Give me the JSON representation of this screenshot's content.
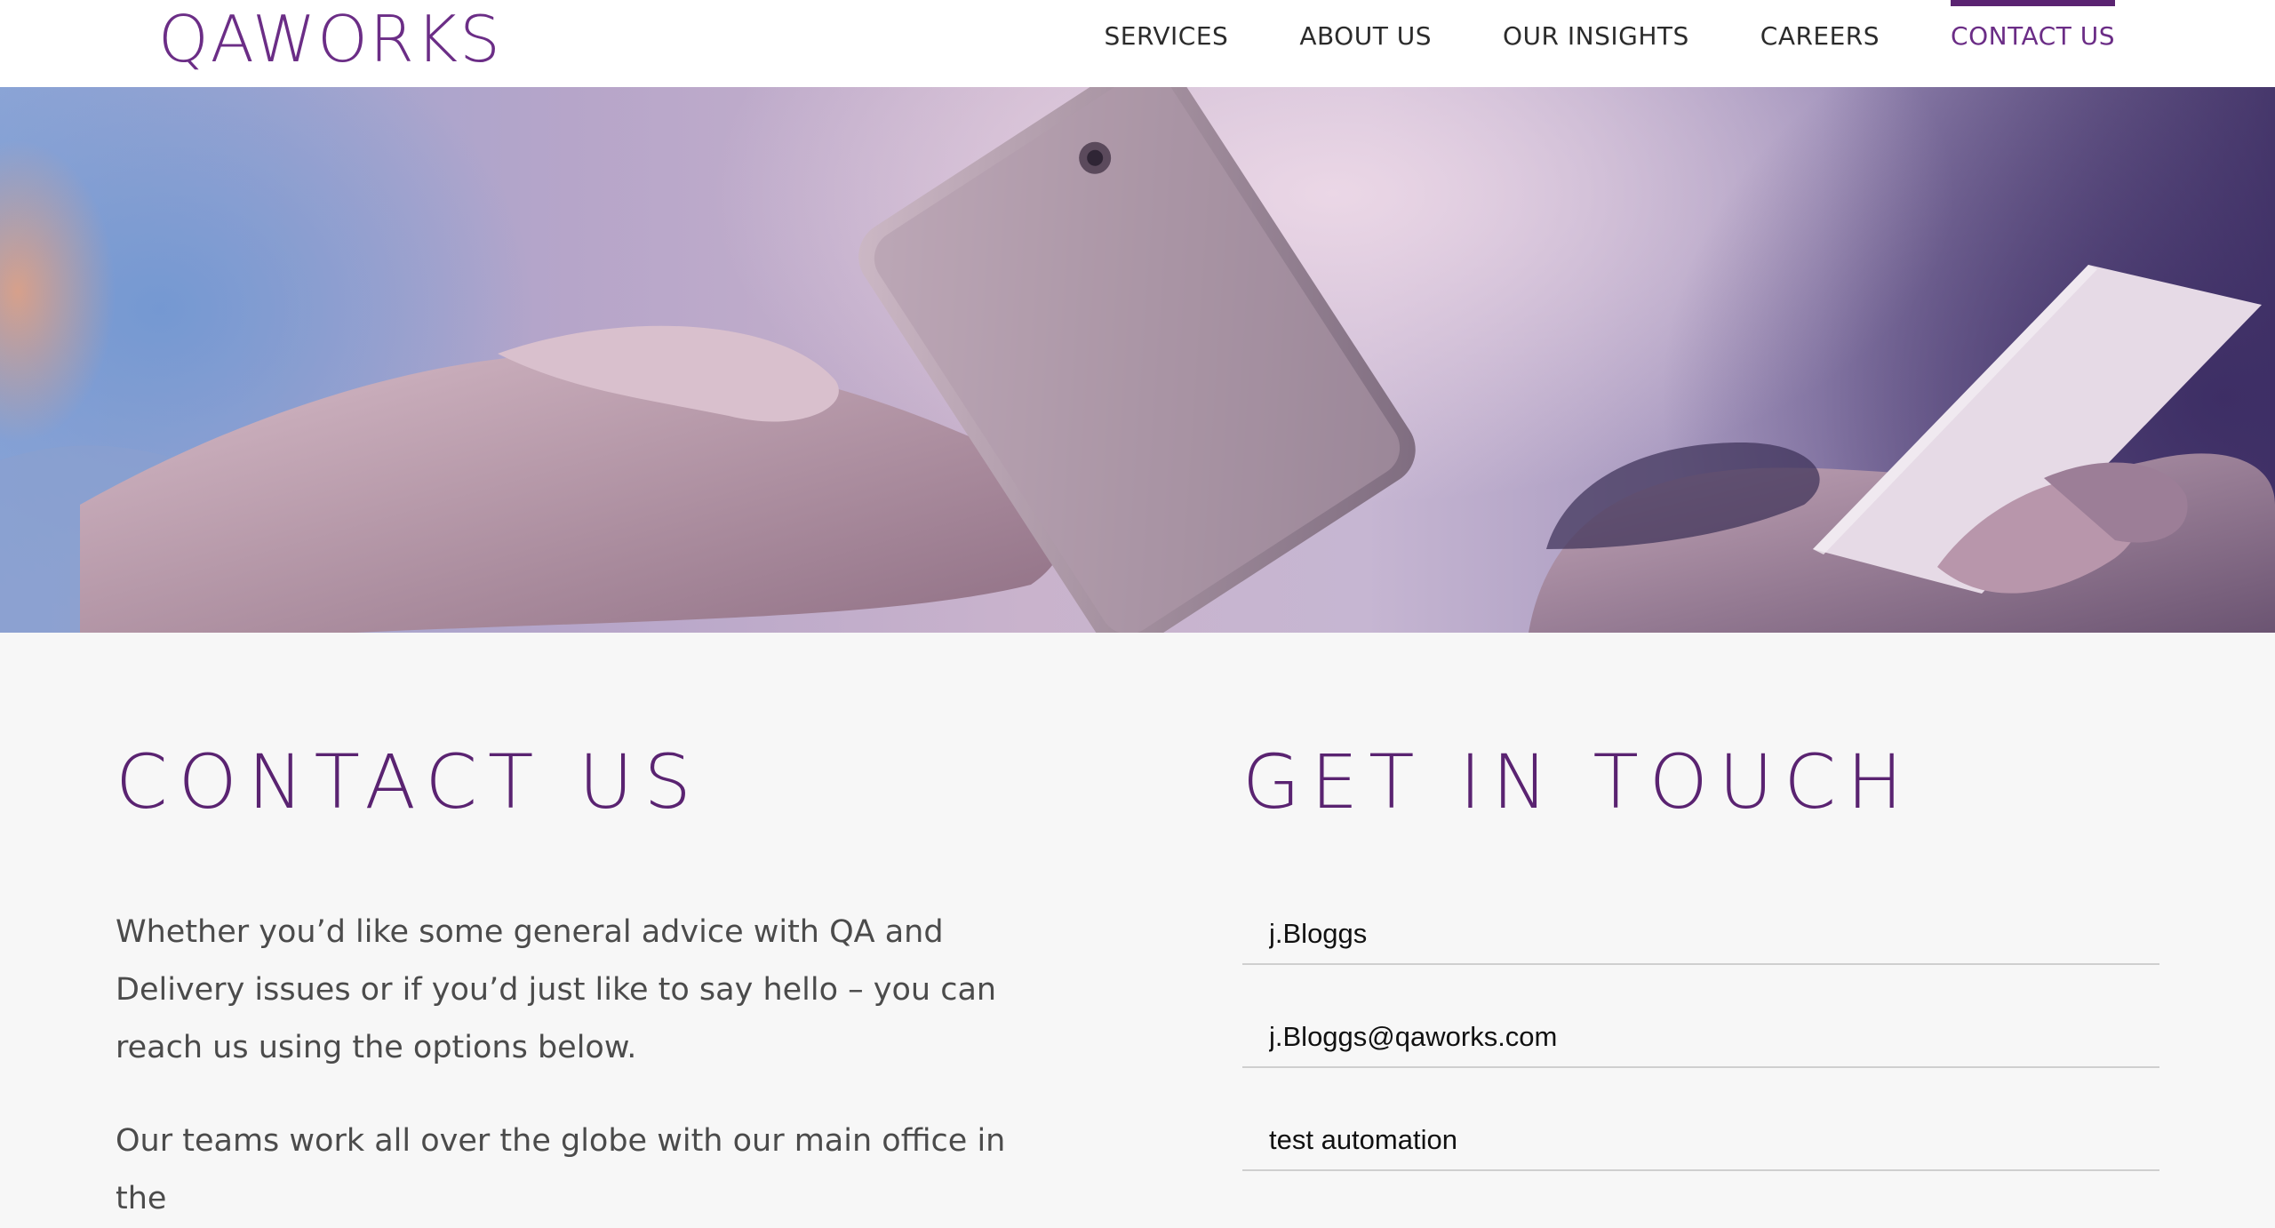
{
  "header": {
    "logo_text": "QAWORKS",
    "nav": [
      {
        "label": "SERVICES",
        "active": false
      },
      {
        "label": "ABOUT US",
        "active": false
      },
      {
        "label": "OUR INSIGHTS",
        "active": false
      },
      {
        "label": "CAREERS",
        "active": false
      },
      {
        "label": "CONTACT US",
        "active": true
      }
    ]
  },
  "contact": {
    "heading": "CONTACT US",
    "paragraph1": "Whether you’d like some general advice with QA and Delivery issues or if you’d just like to say hello – you can reach us using the options below.",
    "paragraph2": "Our teams work all over the globe with our main office in the"
  },
  "form": {
    "heading": "GET IN TOUCH",
    "name_value": "j.Bloggs",
    "email_value": "j.Bloggs@qaworks.com",
    "message_value": "test automation"
  },
  "colors": {
    "brand_purple": "#5a2371",
    "nav_text": "#2b2b2b",
    "body_text": "#4b4b4b",
    "background": "#f7f7f7"
  }
}
